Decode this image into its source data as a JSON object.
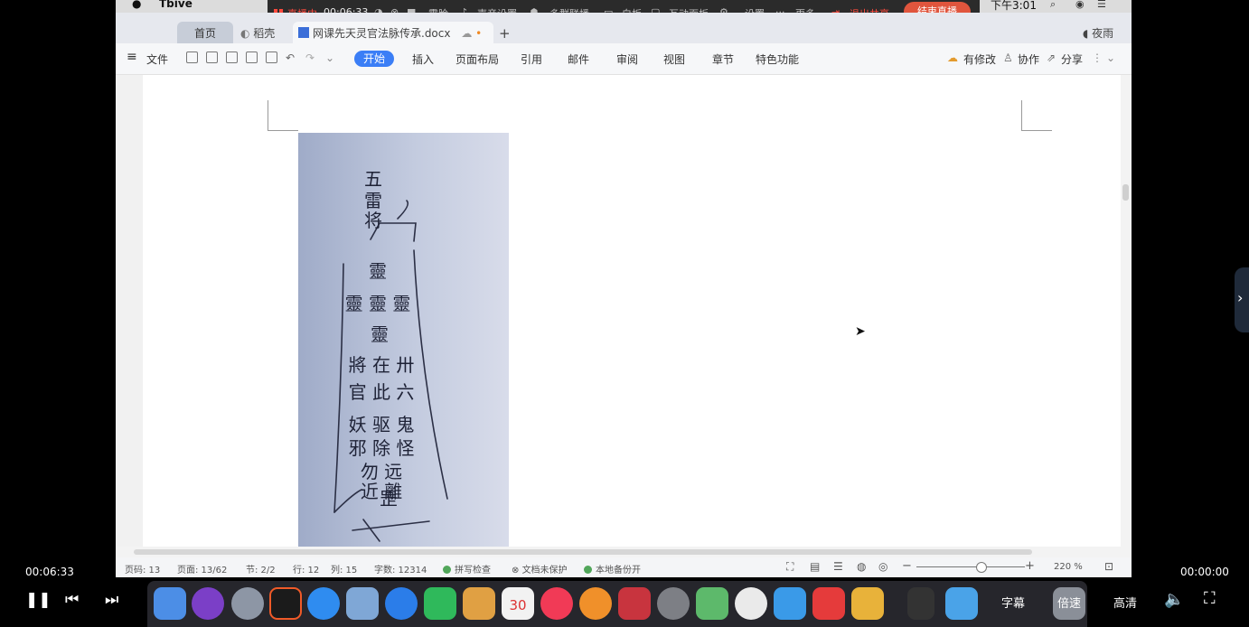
{
  "menubar": {
    "app_name": "Tbive",
    "time": "下午3:01"
  },
  "live": {
    "status": "直播中",
    "duration": "00:06:33",
    "items": [
      "露脸",
      "声音设置",
      "多群联播",
      "白板",
      "互动面板",
      "设置",
      "更多"
    ],
    "exit_share": "退出共享",
    "end_live": "结束直播"
  },
  "wps": {
    "tabs": {
      "home": "首页",
      "daoke": "稻壳",
      "doc": "网课先天灵官法脉传承.docx",
      "add": "+"
    },
    "night_mode": "夜雨",
    "menu": "文件",
    "ribbon": [
      "开始",
      "插入",
      "页面布局",
      "引用",
      "邮件",
      "审阅",
      "视图",
      "章节",
      "特色功能"
    ],
    "right_actions": [
      "有修改",
      "协作",
      "分享"
    ],
    "status": {
      "page_code": "页码: 13",
      "pages": "页面: 13/62",
      "section": "节: 2/2",
      "row": "行: 12",
      "col": "列: 15",
      "words": "字数: 12314",
      "spell": "拼写检查",
      "protect": "文档未保护",
      "backup": "本地备份开",
      "zoom": "220 %"
    }
  },
  "talisman": {
    "top": [
      "五",
      "雷",
      "将"
    ],
    "lines": [
      "靈",
      "靈 靈 靈",
      "靈",
      "將 在 卅",
      "官 此 六",
      "妖 驱 鬼",
      "邪 除 怪",
      "勿 远",
      "近 離",
      "罡"
    ]
  },
  "player": {
    "current_time": "00:06:33",
    "total_time": "00:00:00",
    "subtitle": "字幕",
    "speed": "倍速",
    "quality": "高清"
  },
  "dock": {
    "calendar_day": "30"
  }
}
